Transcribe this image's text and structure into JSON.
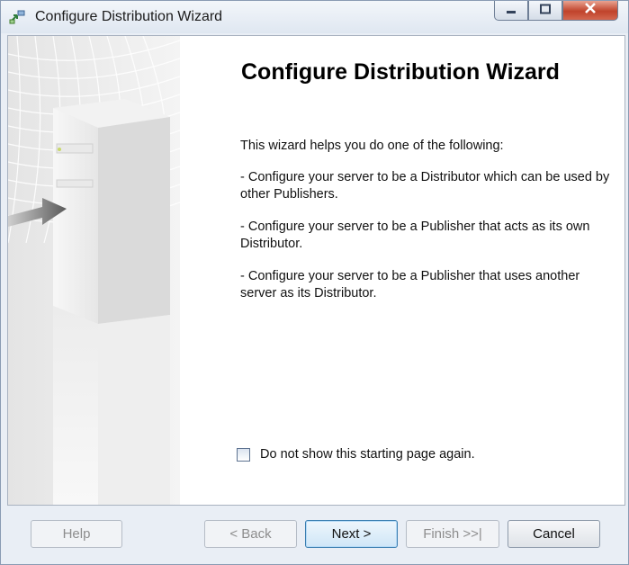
{
  "window": {
    "title": "Configure Distribution Wizard",
    "app_icon": "replication-wizard-icon",
    "controls": {
      "minimize_icon": "minimize-icon",
      "maximize_icon": "maximize-icon",
      "close_icon": "close-icon"
    }
  },
  "wizard": {
    "title": "Configure Distribution Wizard",
    "intro": "This wizard helps you do one of the following:",
    "options": [
      "- Configure your server to be a Distributor which can be used by other Publishers.",
      "- Configure your server to be a Publisher that acts as its own Distributor.",
      "- Configure your server to be a Publisher that uses another server as its Distributor."
    ],
    "checkbox": {
      "label": "Do not show this starting page again.",
      "checked": false
    },
    "sidebar_graphic": "server-arrow-graphic"
  },
  "buttons": {
    "help": "Help",
    "back": "< Back",
    "next": "Next >",
    "finish": "Finish >>|",
    "cancel": "Cancel"
  },
  "colors": {
    "window_frame": "#e9eef5",
    "close_button": "#c0432b",
    "primary_button_border": "#3c7fb1"
  }
}
